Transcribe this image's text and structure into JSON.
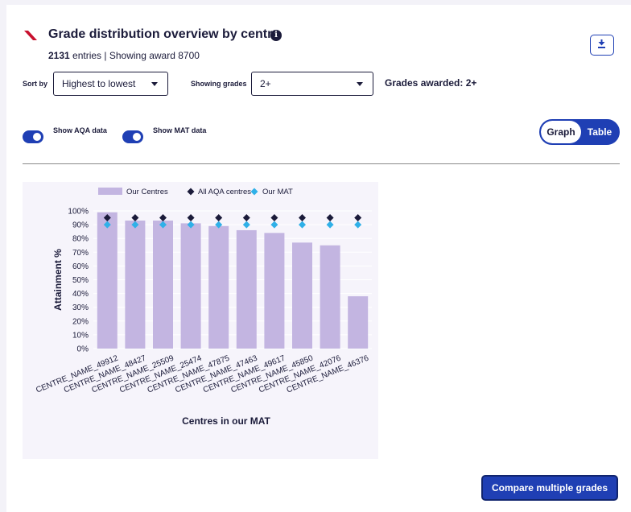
{
  "header": {
    "title": "Grade distribution overview by centre",
    "entries_count": "2131",
    "entries_suffix": " entries | Showing award 8700"
  },
  "controls": {
    "sort_label": "Sort by",
    "sort_value": "Highest to lowest",
    "grades_label": "Showing grades",
    "grades_value": "2+",
    "grades_awarded": "Grades awarded: 2+",
    "show_aqa_label": "Show AQA data",
    "show_mat_label": "Show MAT data",
    "show_aqa_on": true,
    "show_mat_on": true,
    "view_graph": "Graph",
    "view_table": "Table",
    "view_selected": "Graph"
  },
  "footer": {
    "compare_button": "Compare multiple grades"
  },
  "colors": {
    "accent": "#1f3fb4",
    "bar": "#c3b5e1",
    "aqa_marker": "#1b1b3a",
    "mat_marker": "#2fb0e8",
    "logo": "#c8102e"
  },
  "chart_data": {
    "type": "bar",
    "xlabel": "Centres in our MAT",
    "ylabel": "Attainment %",
    "ylim": [
      0,
      100
    ],
    "yticks": [
      "0%",
      "10%",
      "20%",
      "30%",
      "40%",
      "50%",
      "60%",
      "70%",
      "80%",
      "90%",
      "100%"
    ],
    "legend_position": "top",
    "grid": true,
    "categories": [
      "CENTRE_NAME_49912",
      "CENTRE_NAME_48427",
      "CENTRE_NAME_25509",
      "CENTRE_NAME_25474",
      "CENTRE_NAME_47875",
      "CENTRE_NAME_47463",
      "CENTRE_NAME_49617",
      "CENTRE_NAME_45850",
      "CENTRE_NAME_42076",
      "CENTRE_NAME_46376"
    ],
    "series": [
      {
        "name": "Our Centres",
        "kind": "bar",
        "values": [
          99,
          93,
          93,
          91,
          89,
          86,
          84,
          77,
          75,
          38
        ]
      },
      {
        "name": "All AQA centres",
        "kind": "diamond",
        "values": [
          95,
          95,
          95,
          95,
          95,
          95,
          95,
          95,
          95,
          95
        ]
      },
      {
        "name": "Our MAT",
        "kind": "diamond",
        "values": [
          90,
          90,
          90,
          90,
          90,
          90,
          90,
          90,
          90,
          90
        ]
      }
    ]
  }
}
